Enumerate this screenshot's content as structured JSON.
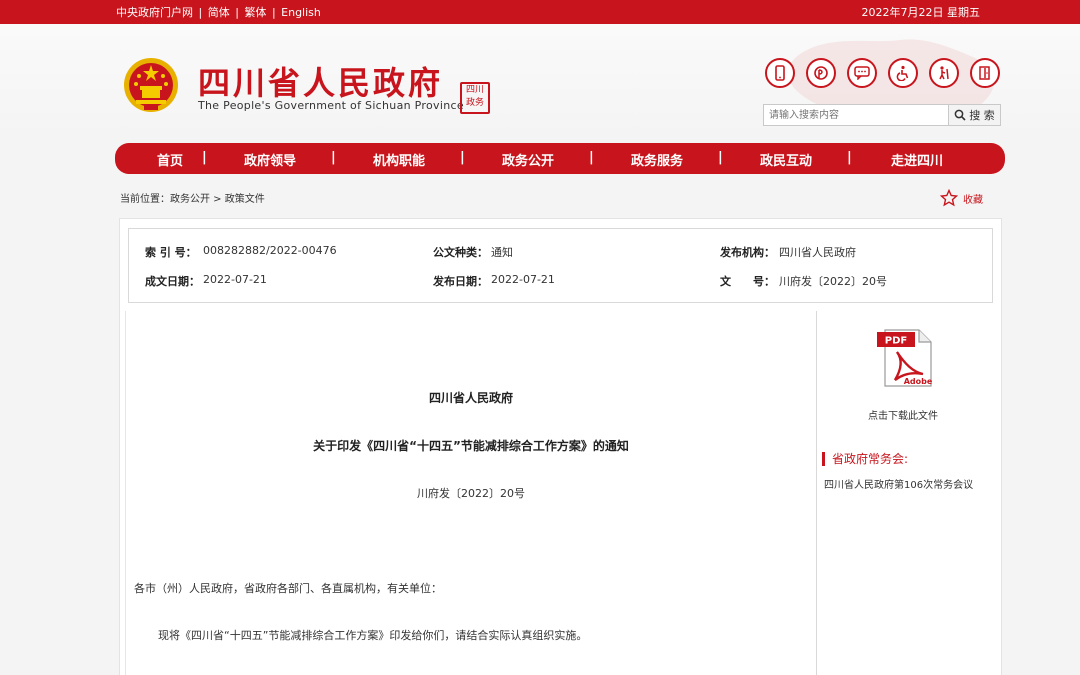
{
  "topbar": {
    "links": [
      "中央政府门户网",
      "|",
      "简体",
      "|",
      "繁体",
      "|",
      "English"
    ],
    "date": "2022年7月22日 星期五"
  },
  "header": {
    "title": "四川省人民政府",
    "subtitle": "The People's Government of Sichuan Province",
    "seal_lines": [
      "四川",
      "政务"
    ]
  },
  "tools": {
    "icons": [
      "mobile-icon",
      "weibo-icon",
      "chat-icon",
      "accessibility-icon",
      "elder-care-icon",
      "exit-icon"
    ]
  },
  "search": {
    "placeholder": "请输入搜索内容",
    "button_label": "搜 索"
  },
  "nav": {
    "items": [
      "首页",
      "政府领导",
      "机构职能",
      "政务公开",
      "政务服务",
      "政民互动",
      "走进四川"
    ],
    "separator": "|"
  },
  "breadcrumb": {
    "text": "当前位置：政务公开 > 政策文件"
  },
  "favorite": {
    "label": "收藏"
  },
  "meta": {
    "index_label": "索 引 号：",
    "index_value": "008282882/2022-00476",
    "type_label": "公文种类：",
    "type_value": "通知",
    "org_label": "发布机构：",
    "org_value": "四川省人民政府",
    "created_label": "成文日期：",
    "created_value": "2022-07-21",
    "published_label": "发布日期：",
    "published_value": "2022-07-21",
    "docno_label": "文　　号：",
    "docno_value": "川府发〔2022〕20号"
  },
  "document": {
    "issuer": "四川省人民政府",
    "title": "关于印发《四川省“十四五”节能减排综合工作方案》的通知",
    "number": "川府发〔2022〕20号",
    "addressee": "各市（州）人民政府，省政府各部门、各直属机构，有关单位：",
    "body": "现将《四川省“十四五”节能减排综合工作方案》印发给你们，请结合实际认真组织实施。"
  },
  "sidebar": {
    "pdf_label": "点击下载此文件",
    "section_title": "省政府常务会:",
    "link": "四川省人民政府第106次常务会议"
  },
  "colors": {
    "brand_red": "#c8151d"
  }
}
